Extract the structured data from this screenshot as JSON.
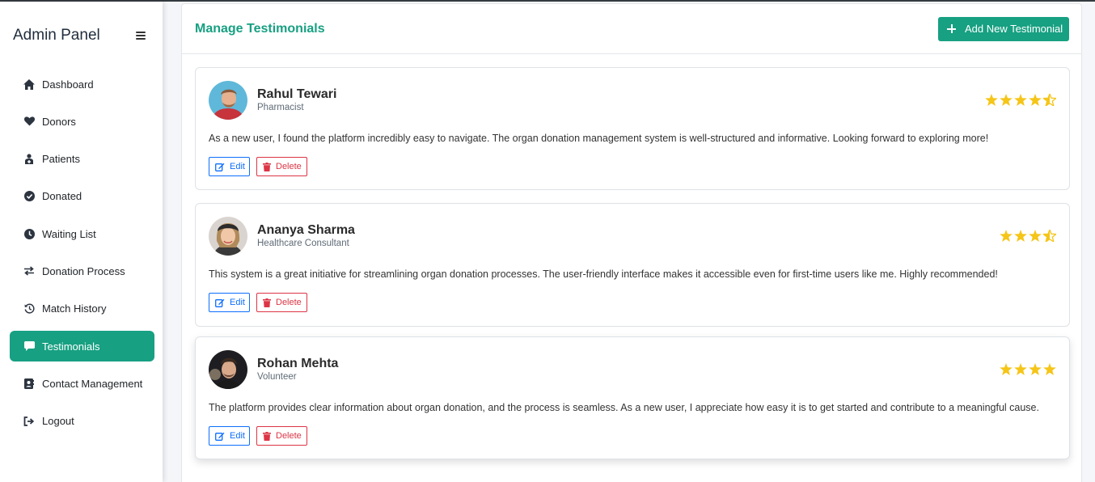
{
  "sidebar": {
    "brand": "Admin Panel",
    "items": [
      {
        "label": "Dashboard",
        "icon": "home-icon"
      },
      {
        "label": "Donors",
        "icon": "heart-icon"
      },
      {
        "label": "Patients",
        "icon": "patient-icon"
      },
      {
        "label": "Donated",
        "icon": "check-circle-icon"
      },
      {
        "label": "Waiting List",
        "icon": "clock-icon"
      },
      {
        "label": "Donation Process",
        "icon": "exchange-icon"
      },
      {
        "label": "Match History",
        "icon": "history-icon"
      },
      {
        "label": "Testimonials",
        "icon": "comment-icon",
        "active": true
      },
      {
        "label": "Contact Management",
        "icon": "address-book-icon"
      },
      {
        "label": "Logout",
        "icon": "logout-icon"
      }
    ]
  },
  "header": {
    "title": "Manage Testimonials",
    "add_label": "Add New Testimonial"
  },
  "testimonials": [
    {
      "name": "Rahul Tewari",
      "role": "Pharmacist",
      "rating": 4.5,
      "text": "As a new user, I found the platform incredibly easy to navigate. The organ donation management system is well-structured and informative. Looking forward to exploring more!",
      "edit_label": "Edit",
      "delete_label": "Delete"
    },
    {
      "name": "Ananya Sharma",
      "role": "Healthcare Consultant",
      "rating": 3.5,
      "text": "This system is a great initiative for streamlining organ donation processes. The user-friendly interface makes it accessible even for first-time users like me. Highly recommended!",
      "edit_label": "Edit",
      "delete_label": "Delete"
    },
    {
      "name": "Rohan Mehta",
      "role": "Volunteer",
      "rating": 4,
      "text": "The platform provides clear information about organ donation, and the process is seamless. As a new user, I appreciate how easy it is to get started and contribute to a meaningful cause.",
      "edit_label": "Edit",
      "delete_label": "Delete"
    }
  ],
  "colors": {
    "accent": "#17a082",
    "star": "#f5c518",
    "edit": "#0d6efd",
    "delete": "#dc3545"
  }
}
